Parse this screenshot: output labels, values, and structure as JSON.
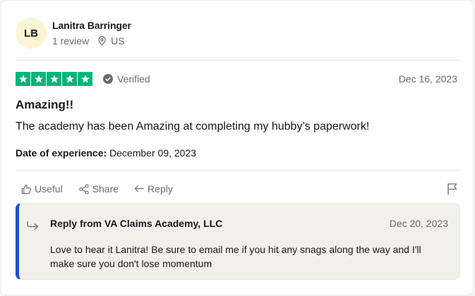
{
  "reviewer": {
    "initials": "LB",
    "name": "Lanitra Barringer",
    "review_count": "1 review",
    "country": "US"
  },
  "review": {
    "rating": 5,
    "verified_label": "Verified",
    "date": "Dec 16, 2023",
    "title": "Amazing!!",
    "body": "The academy has been Amazing at completing my hubby’s paperwork!",
    "experience_label": "Date of experience:",
    "experience_date": "December 09, 2023"
  },
  "actions": {
    "useful": "Useful",
    "share": "Share",
    "reply": "Reply"
  },
  "company_reply": {
    "from": "Reply from VA Claims Academy, LLC",
    "date": "Dec 20, 2023",
    "text": "Love to hear it Lanitra! Be sure to email me if you hit any snags along the way and I'll make sure you don't lose momentum"
  },
  "colors": {
    "star_green": "#00b67a",
    "reply_accent": "#2051c7",
    "avatar_bg": "#fcf5d3"
  }
}
